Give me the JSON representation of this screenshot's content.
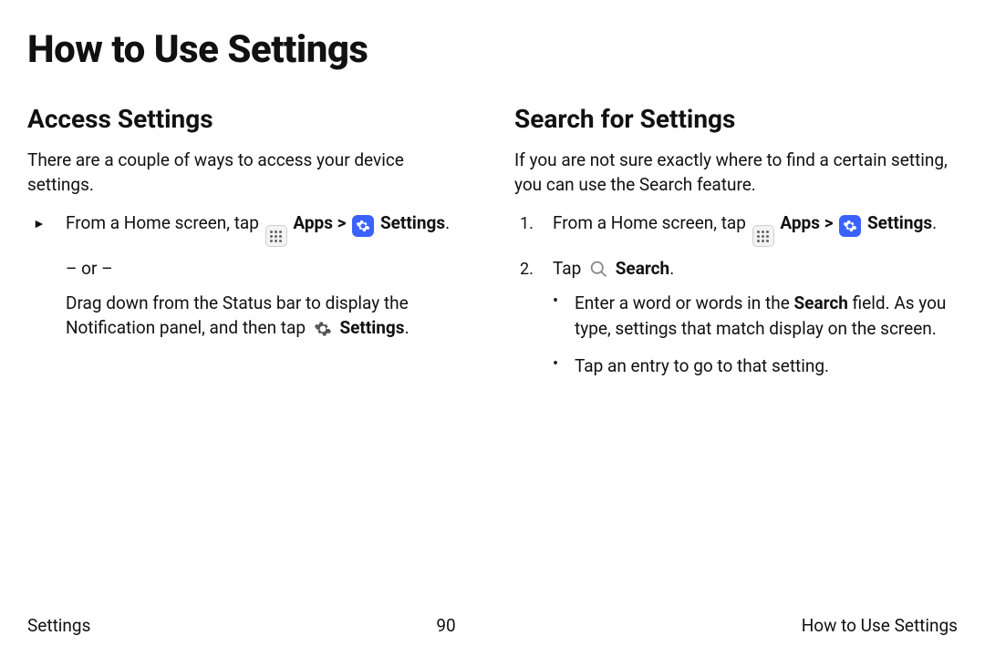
{
  "page_title": "How to Use Settings",
  "left": {
    "heading": "Access Settings",
    "intro": "There are a couple of ways to access your device settings.",
    "step1_prefix": "From a Home screen, tap ",
    "apps_label": "Apps",
    "sep": " > ",
    "settings_label": "Settings",
    "period": ".",
    "or": "– or –",
    "drag_prefix": "Drag down from the Status bar to display the Notification panel, and then tap ",
    "drag_settings": "Settings",
    "drag_suffix": "."
  },
  "right": {
    "heading": "Search for Settings",
    "intro": "If you are not sure exactly where to find a certain setting, you can use the Search feature.",
    "step1_prefix": "From a Home screen, tap ",
    "apps_label": "Apps",
    "sep": " > ",
    "settings_label": "Settings",
    "period": ".",
    "step2_prefix": "Tap ",
    "search_label": "Search",
    "step2_suffix": ".",
    "bullet1_a": "Enter a word or words in the ",
    "bullet1_bold": "Search",
    "bullet1_b": " field. As you type, settings that match display on the screen.",
    "bullet2": "Tap an entry to go to that setting."
  },
  "footer": {
    "left": "Settings",
    "center": "90",
    "right": "How to Use Settings"
  },
  "markers": {
    "tri": "►",
    "n1": "1.",
    "n2": "2.",
    "dot": "•"
  }
}
